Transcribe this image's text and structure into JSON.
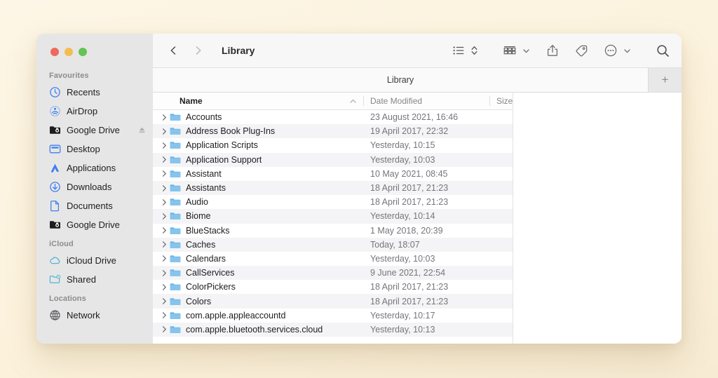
{
  "window": {
    "title": "Library",
    "traffic_lights": [
      {
        "name": "close",
        "color": "#ED6A5E"
      },
      {
        "name": "minimize",
        "color": "#F4BD4F"
      },
      {
        "name": "maximize",
        "color": "#61C454"
      }
    ]
  },
  "desktop": {
    "background_color": "#FCF3DE"
  },
  "toolbar": {
    "back_icon": "chevron-left-icon",
    "forward_icon": "chevron-right-icon",
    "view_icon": "list-view-icon",
    "view_sort_icon": "chevron-up-down-icon",
    "group_icon": "group-by-icon",
    "group_chevron_icon": "chevron-down-icon",
    "share_icon": "share-icon",
    "tag_icon": "tag-icon",
    "more_icon": "ellipsis-circle-icon",
    "more_chevron_icon": "chevron-down-icon",
    "search_icon": "search-icon"
  },
  "tabbar": {
    "active_tab": "Library",
    "add_tab_label": "+"
  },
  "sidebar": {
    "sections": [
      {
        "title": "Favourites",
        "items": [
          {
            "label": "Recents",
            "icon": "clock-icon"
          },
          {
            "label": "AirDrop",
            "icon": "airdrop-icon"
          },
          {
            "label": "Google Drive",
            "icon": "folder-badge-icon",
            "eject": true
          },
          {
            "label": "Desktop",
            "icon": "desktop-icon"
          },
          {
            "label": "Applications",
            "icon": "applications-icon"
          },
          {
            "label": "Downloads",
            "icon": "download-icon"
          },
          {
            "label": "Documents",
            "icon": "document-icon"
          },
          {
            "label": "Google Drive",
            "icon": "folder-badge-icon"
          }
        ]
      },
      {
        "title": "iCloud",
        "items": [
          {
            "label": "iCloud Drive",
            "icon": "cloud-icon"
          },
          {
            "label": "Shared",
            "icon": "shared-folder-icon"
          }
        ]
      },
      {
        "title": "Locations",
        "items": [
          {
            "label": "Network",
            "icon": "globe-icon"
          }
        ]
      }
    ]
  },
  "file_list": {
    "columns": [
      {
        "key": "name",
        "label": "Name",
        "sorted": true,
        "sort_direction": "ascending"
      },
      {
        "key": "date",
        "label": "Date Modified"
      },
      {
        "key": "size",
        "label": "Size"
      }
    ],
    "rows": [
      {
        "name": "Accounts",
        "date": "23 August 2021, 16:46",
        "size": ""
      },
      {
        "name": "Address Book Plug-Ins",
        "date": "19 April 2017, 22:32",
        "size": ""
      },
      {
        "name": "Application Scripts",
        "date": "Yesterday, 10:15",
        "size": ""
      },
      {
        "name": "Application Support",
        "date": "Yesterday, 10:03",
        "size": ""
      },
      {
        "name": "Assistant",
        "date": "10 May 2021, 08:45",
        "size": ""
      },
      {
        "name": "Assistants",
        "date": "18 April 2017, 21:23",
        "size": ""
      },
      {
        "name": "Audio",
        "date": "18 April 2017, 21:23",
        "size": ""
      },
      {
        "name": "Biome",
        "date": "Yesterday, 10:14",
        "size": ""
      },
      {
        "name": "BlueStacks",
        "date": "1 May 2018, 20:39",
        "size": ""
      },
      {
        "name": "Caches",
        "date": "Today, 18:07",
        "size": ""
      },
      {
        "name": "Calendars",
        "date": "Yesterday, 10:03",
        "size": ""
      },
      {
        "name": "CallServices",
        "date": "9 June 2021, 22:54",
        "size": ""
      },
      {
        "name": "ColorPickers",
        "date": "18 April 2017, 21:23",
        "size": ""
      },
      {
        "name": "Colors",
        "date": "18 April 2017, 21:23",
        "size": ""
      },
      {
        "name": "com.apple.appleaccountd",
        "date": "Yesterday, 10:17",
        "size": ""
      },
      {
        "name": "com.apple.bluetooth.services.cloud",
        "date": "Yesterday, 10:13",
        "size": ""
      }
    ]
  }
}
